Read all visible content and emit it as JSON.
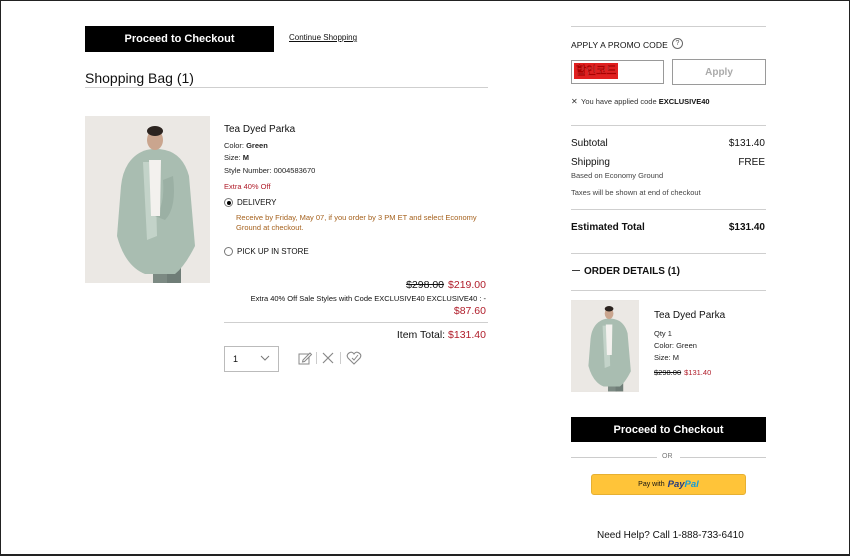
{
  "cart": {
    "checkout_label": "Proceed to Checkout",
    "continue_label": "Continue Shopping",
    "bag_title": "Shopping Bag (1)"
  },
  "item": {
    "name": "Tea Dyed Parka",
    "color_label": "Color: ",
    "color_value": "Green",
    "size_label": "Size: ",
    "size_value": "M",
    "style_label": "Style Number: ",
    "style_value": "0004583670",
    "discount_tag": "Extra 40% Off",
    "delivery_label": "DELIVERY",
    "delivery_note": "Receive by Friday, May 07, if you order by 3 PM ET and select Economy Ground at checkout.",
    "pickup_label": "PICK UP IN STORE",
    "original_price": "$298.00",
    "sale_price": "$219.00",
    "promo_line": "Extra 40% Off Sale Styles with Code EXCLUSIVE40 EXCLUSIVE40 : -",
    "promo_amount": "$87.60",
    "item_total_label": "Item Total:",
    "item_total_value": "$131.40",
    "quantity": "1"
  },
  "summary": {
    "promo_heading": "APPLY A PROMO CODE",
    "help_glyph": "?",
    "promo_code_text": "할인코드",
    "apply_label": "Apply",
    "applied_x": "✕",
    "applied_prefix": "You have applied code ",
    "applied_code": "EXCLUSIVE40",
    "subtotal_label": "Subtotal",
    "subtotal_value": "$131.40",
    "shipping_label": "Shipping",
    "shipping_value": "FREE",
    "shipping_method": "Based on Economy Ground",
    "tax_note": "Taxes will be shown at end of checkout",
    "estimated_label": "Estimated Total",
    "estimated_value": "$131.40"
  },
  "order_details": {
    "heading": "ORDER DETAILS (1)",
    "collapse_glyph": "—",
    "name": "Tea Dyed Parka",
    "qty": "Qty 1",
    "color": "Color: Green",
    "size": "Size: M",
    "original_price": "$298.00",
    "sale_price": "$131.40"
  },
  "payment": {
    "checkout_label": "Proceed to Checkout",
    "or_label": "OR",
    "paypal_prefix": "Pay with",
    "paypal_brand_1": "Pay",
    "paypal_brand_2": "Pal"
  },
  "help": {
    "text": "Need Help? Call 1-888-733-6410"
  },
  "colors": {
    "accent_red": "#b01d2a",
    "paypal_yellow": "#ffc439",
    "delivery_note": "#a5611d"
  }
}
